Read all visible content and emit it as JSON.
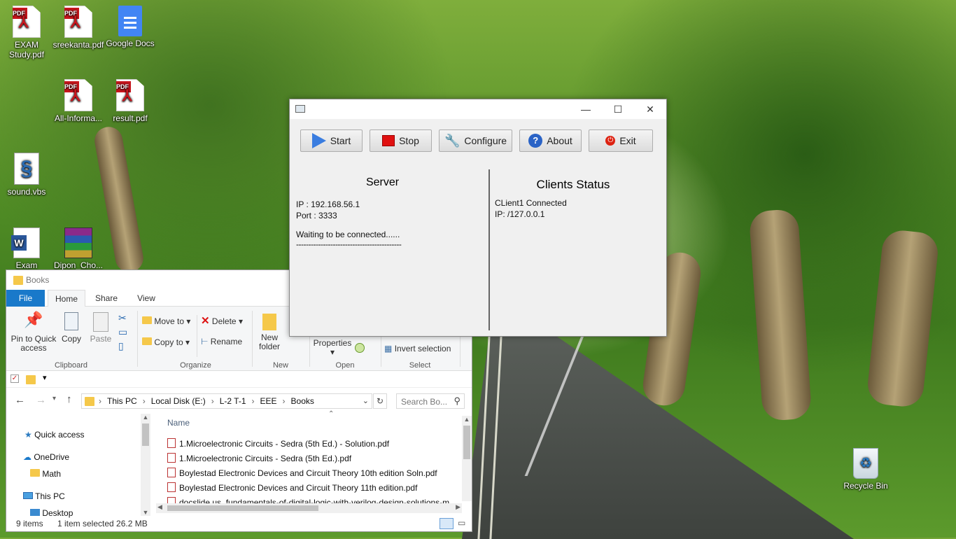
{
  "desktop": {
    "icons": [
      {
        "label": "EXAM Study.pdf",
        "type": "pdf-icon"
      },
      {
        "label": "sreekanta.pdf",
        "type": "pdf-icon"
      },
      {
        "label": "Google Docs",
        "type": "google-docs-icon"
      },
      {
        "label": "All-Informa...",
        "type": "pdf-icon"
      },
      {
        "label": "result.pdf",
        "type": "pdf-icon"
      },
      {
        "label": "sound.vbs",
        "type": "script-icon"
      },
      {
        "label": "Exam",
        "type": "word-icon"
      },
      {
        "label": "Dipon_Cho...",
        "type": "winrar-icon"
      },
      {
        "label": "Recycle Bin",
        "type": "recycle-bin-icon"
      }
    ],
    "pdf_tag": "PDF",
    "word_letter": "W"
  },
  "server_window": {
    "buttons": {
      "start": "Start",
      "stop": "Stop",
      "configure": "Configure",
      "about": "About",
      "exit": "Exit"
    },
    "server_heading": "Server",
    "ip": "IP : 192.168.56.1",
    "port": "Port : 3333",
    "waiting": "Waiting to be connected......",
    "separator": "-------------------------------------------",
    "clients_heading": "Clients Status",
    "client_line1": "CLient1 Connected",
    "client_line2": "IP: /127.0.0.1",
    "colors": {
      "start_icon": "#3a7de0",
      "stop_icon": "#e01010",
      "about_icon": "#2a63c6",
      "exit_icon": "#d21111"
    }
  },
  "explorer": {
    "title": "Books",
    "tabs": {
      "file": "File",
      "home": "Home",
      "share": "Share",
      "view": "View"
    },
    "ribbon": {
      "pin": "Pin to Quick access",
      "copy": "Copy",
      "paste": "Paste",
      "move_to": "Move to",
      "copy_to": "Copy to",
      "delete": "Delete",
      "rename": "Rename",
      "new_folder": "New folder",
      "properties": "Properties",
      "invert_selection": "Invert selection",
      "groups": {
        "clipboard": "Clipboard",
        "organize": "Organize",
        "new": "New",
        "open": "Open",
        "select": "Select"
      }
    },
    "breadcrumb": [
      "This PC",
      "Local Disk (E:)",
      "L-2 T-1",
      "EEE",
      "Books"
    ],
    "search_placeholder": "Search Bo...",
    "nav_pane": {
      "quick_access": "Quick access",
      "onedrive": "OneDrive",
      "math": "Math",
      "this_pc": "This PC",
      "desktop": "Desktop"
    },
    "column_name": "Name",
    "files": [
      "1.Microelectronic Circuits - Sedra (5th Ed.) - Solution.pdf",
      "1.Microelectronic Circuits - Sedra (5th Ed.).pdf",
      "Boylestad Electronic Devices and Circuit Theory 10th edition Soln.pdf",
      "Boylestad Electronic Devices and Circuit Theory 11th edition.pdf",
      "docslide.us_fundamentals-of-digital-logic-with-verilog-design-solutions-m"
    ],
    "status_items": "9 items",
    "status_selected": "1 item selected  26.2 MB",
    "accent": "#1979ca"
  }
}
